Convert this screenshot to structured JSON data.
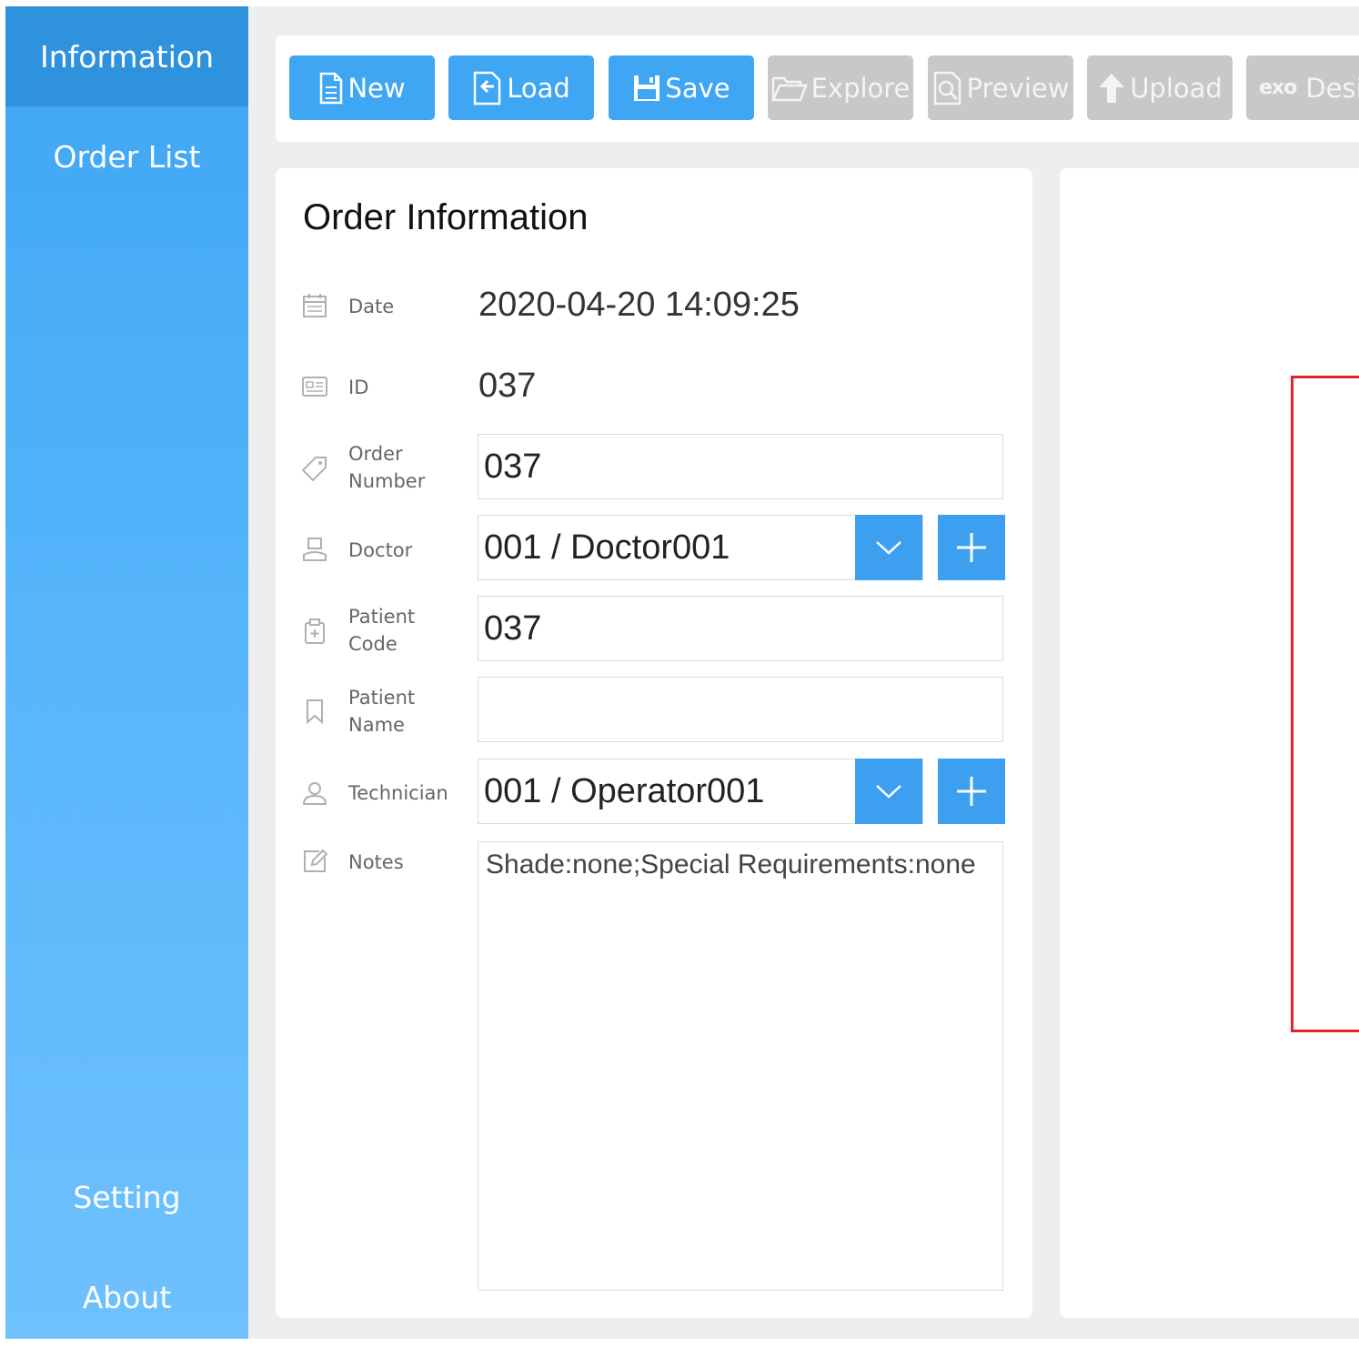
{
  "sidebar": {
    "items": [
      {
        "label": "Information"
      },
      {
        "label": "Order List"
      },
      {
        "label": "Setting"
      },
      {
        "label": "About"
      }
    ]
  },
  "toolbar": {
    "new": "New",
    "load": "Load",
    "save": "Save",
    "explore": "Explore",
    "preview": "Preview",
    "upload": "Upload",
    "exo_logo": "exo",
    "design": "Desig"
  },
  "order": {
    "title": "Order Information",
    "date_label": "Date",
    "date_value": "2020-04-20 14:09:25",
    "id_label": "ID",
    "id_value": "037",
    "order_number_label_1": "Order",
    "order_number_label_2": "Number",
    "order_number_value": "037",
    "doctor_label": "Doctor",
    "doctor_value": "001 / Doctor001",
    "patient_code_label_1": "Patient",
    "patient_code_label_2": "Code",
    "patient_code_value": "037",
    "patient_name_label_1": "Patient",
    "patient_name_label_2": "Name",
    "patient_name_value": "",
    "technician_label": "Technician",
    "technician_value": "001 / Operator001",
    "notes_label": "Notes",
    "notes_value": "Shade:none;Special Requirements:none"
  },
  "colors": {
    "accent": "#3ea6f3",
    "sidebar_active": "#2e92dc",
    "disabled": "#c8c8c8",
    "highlight_frame": "#e0242b"
  },
  "icons": {
    "date": "calendar-icon",
    "id": "id-card-icon",
    "order_number": "tag-icon",
    "doctor": "doctor-icon",
    "patient_code": "patient-code-icon",
    "patient_name": "bookmark-icon",
    "technician": "user-icon",
    "notes": "edit-icon"
  }
}
